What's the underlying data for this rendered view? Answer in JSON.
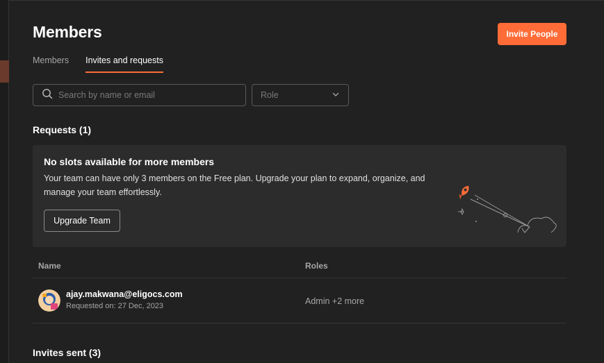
{
  "header": {
    "title": "Members",
    "invite_label": "Invite People"
  },
  "tabs": [
    {
      "label": "Members",
      "active": false
    },
    {
      "label": "Invites and requests",
      "active": true
    }
  ],
  "filters": {
    "search_placeholder": "Search by name or email",
    "role_placeholder": "Role"
  },
  "requests": {
    "heading": "Requests (1)",
    "banner": {
      "title": "No slots available for more members",
      "body": "Your team can have only 3 members on the Free plan. Upgrade your plan to expand, organize, and manage your team effortlessly.",
      "button_label": "Upgrade Team"
    },
    "table": {
      "columns": [
        "Name",
        "Roles"
      ],
      "rows": [
        {
          "email": "ajay.makwana@eligocs.com",
          "requested": "Requested on: 27 Dec, 2023",
          "roles": "Admin +2 more"
        }
      ]
    }
  },
  "invites": {
    "heading": "Invites sent (3)"
  },
  "colors": {
    "accent": "#ff6c37",
    "background": "#212121",
    "card": "#2c2c2c"
  }
}
